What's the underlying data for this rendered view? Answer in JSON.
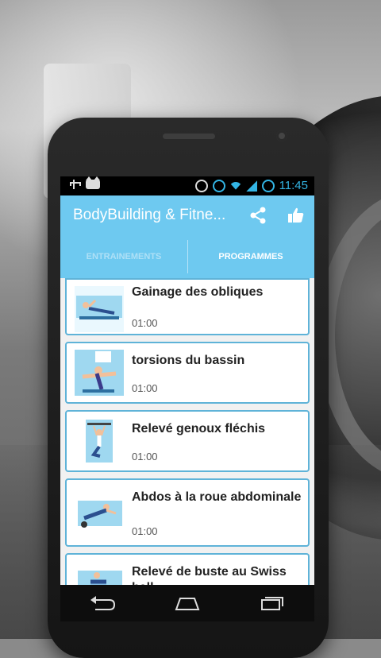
{
  "status_bar": {
    "time": "11:45",
    "icons": [
      "usb-icon",
      "android-debug-icon",
      "sync-icon",
      "alarm-icon",
      "wifi-icon",
      "signal-icon",
      "battery-icon"
    ]
  },
  "action_bar": {
    "title": "BodyBuilding & Fitne...",
    "actions": [
      "share-icon",
      "thumbs-up-icon"
    ]
  },
  "tabs": [
    {
      "label": "ENTRAINEMENTS",
      "selected": false
    },
    {
      "label": "PROGRAMMES",
      "selected": true
    }
  ],
  "exercises": [
    {
      "title": "Gainage des obliques",
      "duration": "01:00"
    },
    {
      "title": "torsions du bassin",
      "duration": "01:00"
    },
    {
      "title": "Relevé genoux fléchis",
      "duration": "01:00"
    },
    {
      "title": "Abdos à la roue abdominale",
      "duration": "01:00"
    },
    {
      "title": "Relevé de buste au Swiss ball",
      "duration": ""
    }
  ],
  "nav_bar": [
    "back-icon",
    "home-icon",
    "recents-icon"
  ],
  "colors": {
    "accent": "#6ec9f0",
    "card_border": "#5fb3d8",
    "status_icons": "#33b5e5"
  }
}
